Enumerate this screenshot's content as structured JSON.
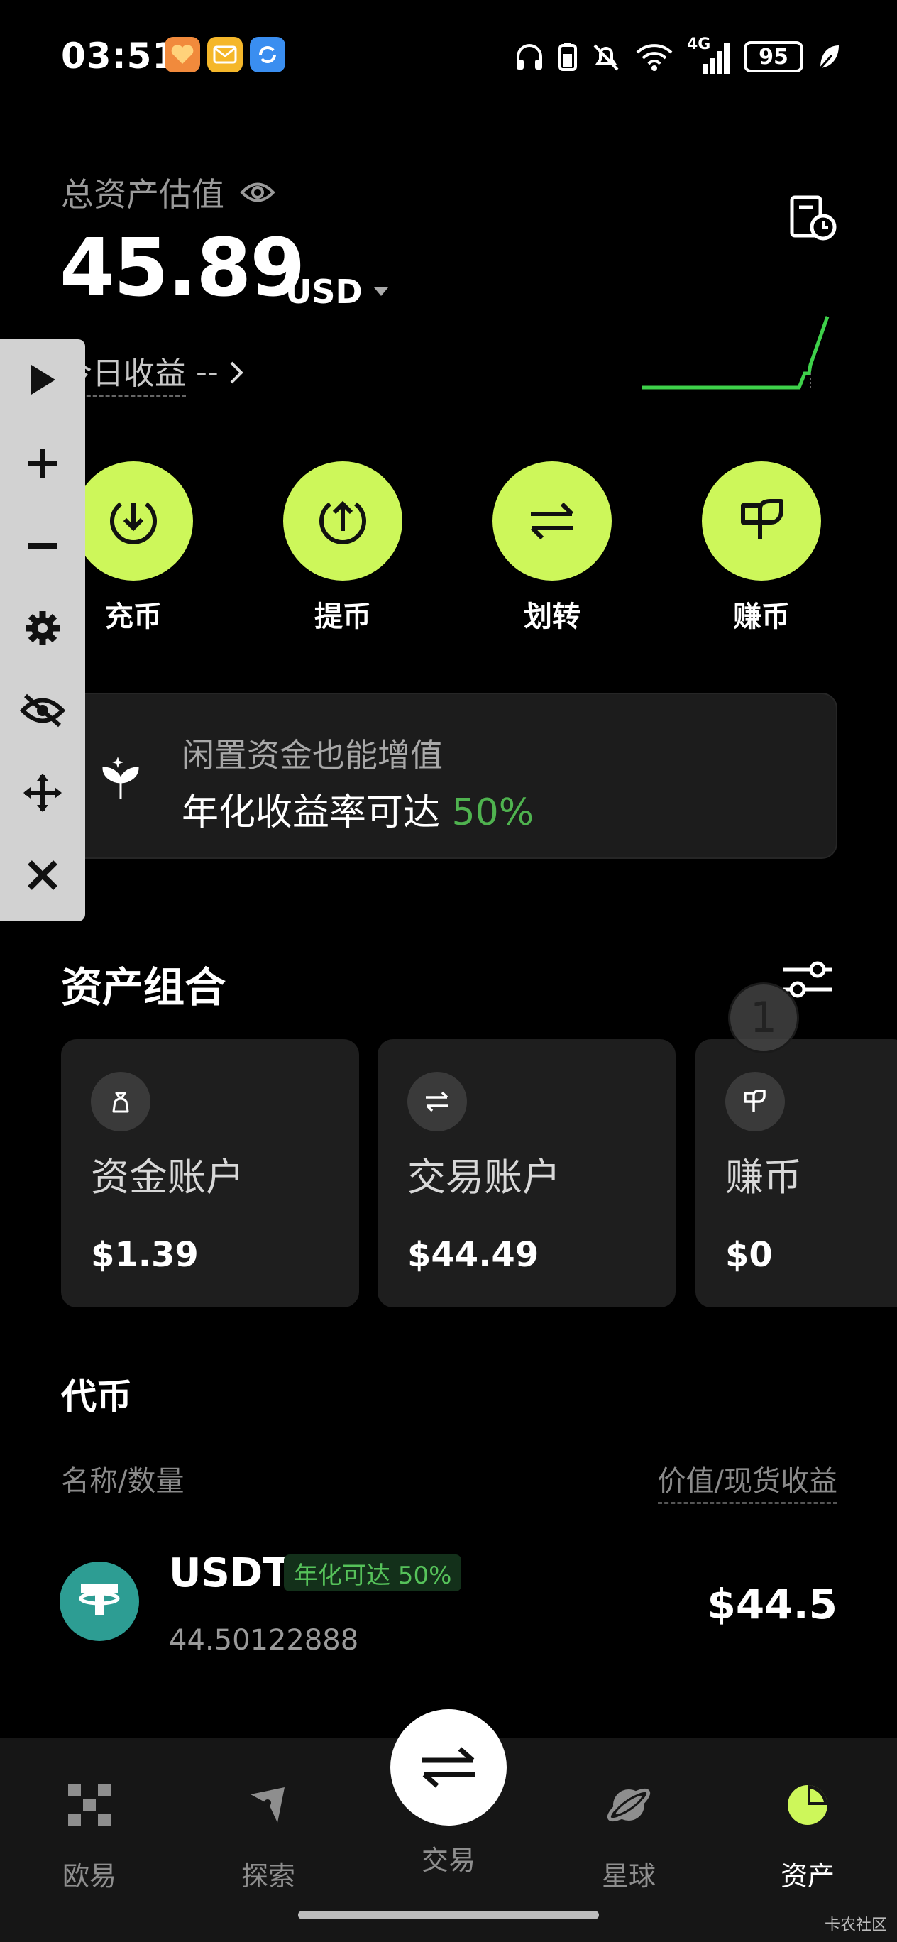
{
  "status_bar": {
    "time": "03:51",
    "battery": "95",
    "network": "4G"
  },
  "header": {
    "total_label": "总资产估值",
    "total_value": "45.89",
    "currency": "USD",
    "today_label": "今日收益",
    "today_value": "--"
  },
  "actions": [
    {
      "label": "充币",
      "icon": "deposit-icon"
    },
    {
      "label": "提币",
      "icon": "withdraw-icon"
    },
    {
      "label": "划转",
      "icon": "transfer-icon"
    },
    {
      "label": "赚币",
      "icon": "earn-icon"
    }
  ],
  "promo": {
    "line1": "闲置资金也能增值",
    "line2": "年化收益率可达 ",
    "rate": "50%"
  },
  "portfolio": {
    "title": "资产组合",
    "cards": [
      {
        "name": "资金账户",
        "value": "$1.39",
        "icon": "moneybag-icon"
      },
      {
        "name": "交易账户",
        "value": "$44.49",
        "icon": "exchange-icon"
      },
      {
        "name": "赚币",
        "value": "$0",
        "icon": "earn-icon"
      }
    ]
  },
  "tokens": {
    "title": "代币",
    "col_left": "名称/数量",
    "col_right": "价值/现货收益",
    "items": [
      {
        "symbol": "USDT",
        "tag": "年化可达 50%",
        "amount": "44.50122888",
        "value": "$44.5"
      }
    ]
  },
  "overlay": {
    "badge": "1"
  },
  "nav": {
    "items": [
      {
        "label": "欧易",
        "icon": "okx-logo-icon"
      },
      {
        "label": "探索",
        "icon": "compass-icon"
      },
      {
        "label": "交易",
        "icon": "swap-icon"
      },
      {
        "label": "星球",
        "icon": "planet-icon"
      },
      {
        "label": "资产",
        "icon": "pie-chart-icon",
        "active": true
      }
    ]
  },
  "watermark": "卡农社区",
  "colors": {
    "accent": "#cdf75a",
    "positive": "#4fb24f",
    "background": "#000000"
  }
}
